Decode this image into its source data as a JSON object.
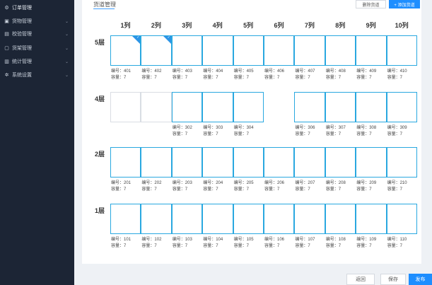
{
  "sidebar": {
    "items": [
      {
        "label": "订单管理",
        "icon": "gear-icon"
      },
      {
        "label": "货物管理",
        "icon": "cube-icon"
      },
      {
        "label": "校验管理",
        "icon": "document-icon"
      },
      {
        "label": "货架管理",
        "icon": "folder-icon"
      },
      {
        "label": "统计管理",
        "icon": "chart-icon"
      },
      {
        "label": "系统设置",
        "icon": "settings-icon"
      }
    ]
  },
  "panel": {
    "title": "货道管理",
    "delete_label": "删除货道",
    "add_label": "+ 添加货道"
  },
  "columns": [
    "1列",
    "2列",
    "3列",
    "4列",
    "5列",
    "6列",
    "7列",
    "8列",
    "9列",
    "10列"
  ],
  "rows": [
    {
      "label": "5层",
      "slots": [
        {
          "state": "selected",
          "code": "编号：401",
          "cap": "容量：7"
        },
        {
          "state": "selected",
          "code": "编号：402",
          "cap": "容量：7"
        },
        {
          "state": "active",
          "code": "编号：403",
          "cap": "容量：7"
        },
        {
          "state": "active",
          "code": "编号：404",
          "cap": "容量：7"
        },
        {
          "state": "active",
          "code": "编号：405",
          "cap": "容量：7"
        },
        {
          "state": "active",
          "code": "编号：406",
          "cap": "容量：7"
        },
        {
          "state": "active",
          "code": "编号：407",
          "cap": "容量：7"
        },
        {
          "state": "active",
          "code": "编号：408",
          "cap": "容量：7"
        },
        {
          "state": "active",
          "code": "编号：409",
          "cap": "容量：7"
        },
        {
          "state": "active",
          "code": "编号：410",
          "cap": "容量：7"
        }
      ]
    },
    {
      "label": "4层",
      "slots": [
        {
          "state": "empty",
          "code": "",
          "cap": ""
        },
        {
          "state": "empty",
          "code": "",
          "cap": ""
        },
        {
          "state": "active",
          "code": "编号：302",
          "cap": "容量：7"
        },
        {
          "state": "active",
          "code": "编号：303",
          "cap": "容量：7"
        },
        {
          "state": "active",
          "code": "编号：304",
          "cap": "容量：7"
        },
        {
          "state": "none",
          "code": "",
          "cap": ""
        },
        {
          "state": "active",
          "code": "编号：306",
          "cap": "容量：7"
        },
        {
          "state": "active",
          "code": "编号：307",
          "cap": "容量：7"
        },
        {
          "state": "active",
          "code": "编号：308",
          "cap": "容量：7"
        },
        {
          "state": "active",
          "code": "编号：309",
          "cap": "容量：7"
        }
      ]
    },
    {
      "label": "2层",
      "slots": [
        {
          "state": "active",
          "code": "编号：201",
          "cap": "容量：7"
        },
        {
          "state": "active",
          "code": "编号：202",
          "cap": "容量：7"
        },
        {
          "state": "active",
          "code": "编号：203",
          "cap": "容量：7"
        },
        {
          "state": "active",
          "code": "编号：204",
          "cap": "容量：7"
        },
        {
          "state": "active",
          "code": "编号：205",
          "cap": "容量：7"
        },
        {
          "state": "active",
          "code": "编号：206",
          "cap": "容量：7"
        },
        {
          "state": "active",
          "code": "编号：207",
          "cap": "容量：7"
        },
        {
          "state": "active",
          "code": "编号：208",
          "cap": "容量：7"
        },
        {
          "state": "active",
          "code": "编号：209",
          "cap": "容量：7"
        },
        {
          "state": "active",
          "code": "编号：210",
          "cap": "容量：7"
        }
      ]
    },
    {
      "label": "1层",
      "slots": [
        {
          "state": "active",
          "code": "编号：101",
          "cap": "容量：7"
        },
        {
          "state": "active",
          "code": "编号：102",
          "cap": "容量：7"
        },
        {
          "state": "active",
          "code": "编号：103",
          "cap": "容量：7"
        },
        {
          "state": "active",
          "code": "编号：104",
          "cap": "容量：7"
        },
        {
          "state": "active",
          "code": "编号：105",
          "cap": "容量：7"
        },
        {
          "state": "active",
          "code": "编号：106",
          "cap": "容量：7"
        },
        {
          "state": "active",
          "code": "编号：107",
          "cap": "容量：7"
        },
        {
          "state": "active",
          "code": "编号：108",
          "cap": "容量：7"
        },
        {
          "state": "active",
          "code": "编号：109",
          "cap": "容量：7"
        },
        {
          "state": "active",
          "code": "编号：110",
          "cap": "容量：7"
        }
      ]
    }
  ],
  "footer": {
    "back_label": "返回",
    "save_label": "保存",
    "submit_label": "发布"
  },
  "colors": {
    "sidebar_bg": "#1c2535",
    "accent": "#1e8eff",
    "slot_border": "#29a8e0"
  }
}
